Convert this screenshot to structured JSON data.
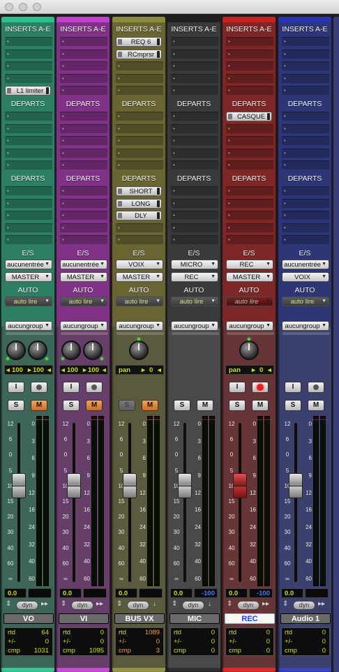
{
  "window": {
    "controls": [
      "close",
      "minimize",
      "zoom"
    ]
  },
  "labels": {
    "inserts": "INSERTS A-E",
    "departs": "DEPARTS",
    "es": "E/S",
    "auto": "AUTO",
    "dyn": "dyn",
    "rtd": "rtd",
    "diff": "+/-",
    "cmp": "cmp",
    "pan": "pan",
    "solo": "S",
    "mute": "M",
    "input": "I"
  },
  "fader_scale": [
    "12",
    "6",
    "0",
    "5",
    "10",
    "15",
    "20",
    "30",
    "40",
    "60",
    "∞"
  ],
  "meter_scale": [
    "0",
    "3",
    "6",
    "9",
    "12",
    "16",
    "24",
    "32",
    "40",
    "60"
  ],
  "channels": [
    {
      "name": "VO",
      "color": "#2e9e79",
      "stripe": "#27c28b",
      "body": "#2c5a4a",
      "inserts": [
        {
          "slot": 5,
          "name": "L1 limiter"
        }
      ],
      "sends1": [],
      "sends2": [],
      "input": "aucunentrée",
      "output": "MASTER",
      "auto_mode": "auto lire",
      "group": "aucungroup",
      "pan_type": "stereo",
      "pan_left": "100",
      "pan_right": "100",
      "input_button": true,
      "rec_armed": false,
      "solo_dim": false,
      "mute_on": true,
      "fader_level": 0.5,
      "volume": "0.0",
      "extra": "",
      "rtd": "64",
      "diff": "0",
      "cmp": "1031",
      "name_selected": false,
      "tail_icon": "arrows"
    },
    {
      "name": "VI",
      "color": "#9e37a8",
      "stripe": "#c43cd1",
      "body": "#5a2e5e",
      "inserts": [],
      "sends1": [],
      "sends2": [],
      "input": "aucunentrée",
      "output": "MASTER",
      "auto_mode": "auto lire",
      "group": "aucungroup",
      "pan_type": "stereo",
      "pan_left": "100",
      "pan_right": "100",
      "input_button": true,
      "rec_armed": false,
      "solo_dim": false,
      "mute_on": true,
      "fader_level": 0.5,
      "volume": "0.0",
      "extra": "",
      "rtd": "0",
      "diff": "0",
      "cmp": "1095",
      "name_selected": false,
      "tail_icon": "arrows"
    },
    {
      "name": "BUS VX",
      "color": "#7e7a3a",
      "stripe": "#8c8a3b",
      "body": "#4f4d2c",
      "inserts": [
        {
          "slot": 1,
          "name": "REQ 6"
        },
        {
          "slot": 2,
          "name": "RCmprsr"
        }
      ],
      "sends1": [],
      "sends2": [
        {
          "slot": 1,
          "name": "SHORT"
        },
        {
          "slot": 2,
          "name": "LONG"
        },
        {
          "slot": 3,
          "name": "DLY"
        }
      ],
      "input": "VOIX",
      "output": "MASTER",
      "auto_mode": "auto lire",
      "group": "aucungroup",
      "pan_type": "mono",
      "pan_value": "0",
      "input_button": false,
      "rec_armed": false,
      "solo_dim": true,
      "mute_on": true,
      "fader_level": 0.5,
      "volume": "0.0",
      "extra": "",
      "rtd": "1089",
      "diff": "0",
      "cmp": "3",
      "name_selected": false,
      "tail_icon": "down-arrow"
    },
    {
      "name": "MIC",
      "color": "#3b3b3b",
      "stripe": "#1f1f1f",
      "body": "#3a3a3a",
      "inserts": [],
      "sends1": [],
      "sends2": [],
      "input": "MICRO",
      "output": "REC",
      "auto_mode": "auto lire",
      "group": "aucungroup",
      "pan_type": "none",
      "input_button": false,
      "rec_armed": false,
      "solo_dim": false,
      "mute_on": false,
      "fader_level": 0.5,
      "volume": "0.0",
      "extra": "-100",
      "rtd": "0",
      "diff": "0",
      "cmp": "0",
      "name_selected": false,
      "tail_icon": "down-arrow"
    },
    {
      "name": "REC",
      "color": "#9b2a2a",
      "stripe": "#d21d1d",
      "body": "#5a2424",
      "inserts": [],
      "sends1": [
        {
          "slot": 1,
          "name": "CASQUE"
        }
      ],
      "sends2": [],
      "input": "REC",
      "output": "MASTER",
      "auto_mode": "auto lire",
      "group": "aucungroup",
      "pan_type": "mono",
      "pan_value": "0",
      "input_button": true,
      "rec_armed": true,
      "solo_dim": false,
      "mute_on": false,
      "fader_level": 0.5,
      "volume": "0.0",
      "extra": "-100",
      "rtd": "0",
      "diff": "0",
      "cmp": "0",
      "name_selected": true,
      "tail_icon": "arrows"
    },
    {
      "name": "Audio 1",
      "color": "#2f3c8a",
      "stripe": "#2a34b8",
      "body": "#2b3160",
      "inserts": [],
      "sends1": [],
      "sends2": [],
      "input": "aucunentrée",
      "output": "VOIX",
      "auto_mode": "auto lire",
      "group": "aucungroup",
      "pan_type": "none",
      "input_button": true,
      "rec_armed": false,
      "solo_dim": false,
      "mute_on": false,
      "fader_level": 0.5,
      "volume": "0.0",
      "extra": "",
      "rtd": "0",
      "diff": "0",
      "cmp": "0",
      "name_selected": false,
      "tail_icon": "arrows"
    }
  ]
}
